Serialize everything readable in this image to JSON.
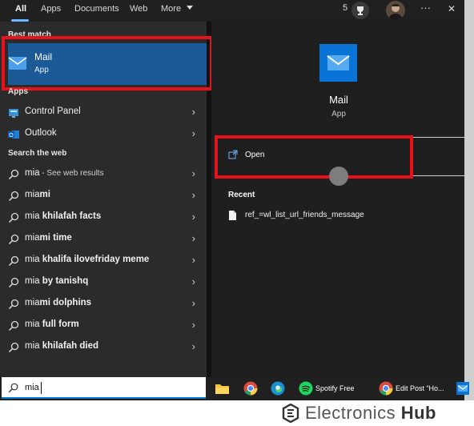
{
  "tabs": [
    {
      "label": "All",
      "active": true
    },
    {
      "label": "Apps",
      "active": false
    },
    {
      "label": "Documents",
      "active": false
    },
    {
      "label": "Web",
      "active": false
    },
    {
      "label": "More",
      "active": false
    }
  ],
  "topbar": {
    "points": "5",
    "more_glyph": "···",
    "close_glyph": "✕"
  },
  "best_match": {
    "section_title": "Best match",
    "name": "Mail",
    "type": "App"
  },
  "apps": {
    "section_title": "Apps",
    "items": [
      {
        "label": "Control Panel",
        "icon": "control-panel-icon"
      },
      {
        "label": "Outlook",
        "icon": "outlook-icon"
      }
    ]
  },
  "web": {
    "section_title": "Search the web",
    "items": [
      {
        "prefix": "mia",
        "rest": "",
        "suffix": " - See web results"
      },
      {
        "prefix": "mia",
        "rest": "mi",
        "suffix": ""
      },
      {
        "prefix": "mia",
        "rest": " khilafah facts",
        "suffix": ""
      },
      {
        "prefix": "mia",
        "rest": "mi time",
        "suffix": ""
      },
      {
        "prefix": "mia",
        "rest": " khalifa ilovefriday meme",
        "suffix": ""
      },
      {
        "prefix": "mia",
        "rest": " by tanishq",
        "suffix": ""
      },
      {
        "prefix": "mia",
        "rest": "mi dolphins",
        "suffix": ""
      },
      {
        "prefix": "mia",
        "rest": " full form",
        "suffix": ""
      },
      {
        "prefix": "mia",
        "rest": " khilafah died",
        "suffix": ""
      }
    ]
  },
  "search": {
    "value": "mia"
  },
  "detail": {
    "name": "Mail",
    "type": "App",
    "open_label": "Open",
    "recent_title": "Recent",
    "recent_items": [
      "ref_=wl_list_url_friends_message"
    ]
  },
  "taskbar": {
    "spotify_label": "Spotify Free",
    "edit_post_label": "Edit Post “Ho..."
  },
  "watermark": {
    "brand_left": "Electronics",
    "brand_right": "Hub"
  },
  "colors": {
    "accent": "#0078d4",
    "selection": "#1b5a96",
    "highlight": "#e8121d",
    "mail_tile": "#0a74d6"
  }
}
